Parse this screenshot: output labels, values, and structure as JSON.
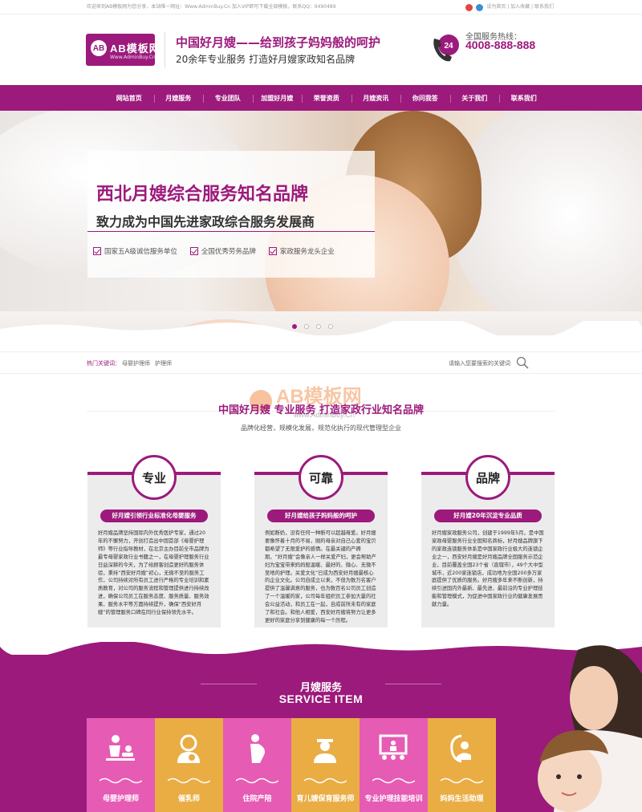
{
  "topbar": {
    "left_text": "欢迎来到AB模板网为您分享，本站唯一网址：Www.AdminBuy.Cn 加入VIP即可下载全部模板，联系QQ：9490489",
    "links": "设为首页 | 加入收藏 | 联系我们"
  },
  "header": {
    "logo_title": "AB模板网",
    "logo_sub": "Www.AdminBuy.Cn",
    "logo_mark": "AB",
    "slogan_main": "中国好月嫂——给到孩子妈妈般的呵护",
    "slogan_sub": "20余年专业服务 打造好月嫂家政知名品牌",
    "phone_badge": "24",
    "hotline_label": "全国服务热线：",
    "hotline_number": "4008-888-888"
  },
  "nav": {
    "items": [
      "网站首页",
      "月嫂服务",
      "专业团队",
      "加盟好月嫂",
      "荣誉资质",
      "月嫂资讯",
      "你问我答",
      "关于我们",
      "联系我们"
    ]
  },
  "banner": {
    "title": "西北月嫂综合服务知名品牌",
    "subtitle": "致力成为中国先进家政综合服务发展商",
    "features": [
      "国家五A级诚信服务单位",
      "全国优秀劳务品牌",
      "家政服务龙头企业"
    ],
    "slide_count": 4,
    "active_slide": 1
  },
  "keywords": {
    "label": "热门关键词：",
    "items": [
      "母婴护理师",
      "护理师"
    ],
    "search_placeholder": "请输入您要搜索的关键词"
  },
  "about": {
    "watermark": "AB模板网",
    "watermark_sub": "www.AdminBuy.Cn",
    "title": "中国好月嫂 专业服务 打造家政行业知名品牌",
    "subtitle": "品牌化经营，规模化发展，规范化执行的现代管理型企业",
    "cards": [
      {
        "badge": "专业",
        "heading": "好月嫂引领行业标准化母婴服务",
        "text": "好月嫂品牌坚持国际内外优秀医护专家，通过20年的不懈努力，开创打造出中国首部《母婴护理师》等行业指导教材，在北京主办目前全市品牌为最专母婴家政行业书籍之一，在母婴护理服务行业日益深耕的今天，为了给顾客创造更好的服务体验，秉持“西安好月嫂”初心，无微不至的服务工作，公司持续对所有员工进行严格的专业培训和素质教育，对公司的服务流程和管理提供进行持续改进，确保公司员工在服务态度、服务质量、服务效果、服务水平等方面持续提升，确保“西安好月嫂”的管理服务口碑在同行业保持领先水平。"
      },
      {
        "badge": "可靠",
        "heading": "好月嫂给孩子妈妈般的呵护",
        "text": "例如断奶，没有任何一种断可以超越母爱。好月嫂要像怀着十月的不易，刚的母亲对自己心爱的宝贝都希望了无限爱护的感情。在最关键的产褥期，“好月嫂”会像亲人一样关爱产妇，更会帮助产妇为宝宝带来妈妈般温暖、最好的、微心、无微不至地的护理。关爱文化“已成为西安好月嫂最核心的企业文化。公司自成立以来，不但为数万名客户提供了温馨满意的服务，也为数百名公司员工创造了一个温暖的家，公司每年组织员工参加大量的社会公益活动，和员工在一起，自成前所未有的家庭了和社会。和他人相爱，西安好月嫂将努力让更多更好的家庭分享到健康的每一个历程。"
      },
      {
        "badge": "品牌",
        "heading": "好月嫂20年沉淀专业品质",
        "text": "好月嫂家政服务公司，创建于1999年5月，是中国家政母婴服务行业全国知名商标，好月嫂品牌旗下的家政连锁服务体系是中国家政行业极大的连锁企业之一，西安好月嫂是好月嫂品牌全国服务示范企业，目前覆盖全国23个省（直辖市），49个大中型城市，近200家连锁店，成功地为全国200多万家庭提供了优质的服务。好月嫂多年来不断创新，持续引进国内外最新、最先进、最前沿的专业护理技能和管理模式，为促进中国家政行业的健康发展贡献力量。"
      }
    ]
  },
  "services": {
    "title_cn": "月嫂服务",
    "title_en": "SERVICE ITEM",
    "tiles": [
      {
        "label": "母婴护理师",
        "color": "#e65bb4",
        "icon": "baby-care-icon"
      },
      {
        "label": "催乳师",
        "color": "#e9ad44",
        "icon": "lactation-icon"
      },
      {
        "label": "住院产陪",
        "color": "#e65bb4",
        "icon": "pregnant-icon"
      },
      {
        "label": "育儿嫂保育服务师",
        "color": "#e9ad44",
        "icon": "nanny-icon"
      },
      {
        "label": "专业护理技能培训",
        "color": "#e65bb4",
        "icon": "training-icon"
      },
      {
        "label": "妈妈生活助理",
        "color": "#e9ad44",
        "icon": "mother-baby-icon"
      }
    ]
  },
  "colors": {
    "brand": "#9c1a7c",
    "pink": "#e65bb4",
    "orange": "#e9ad44"
  }
}
